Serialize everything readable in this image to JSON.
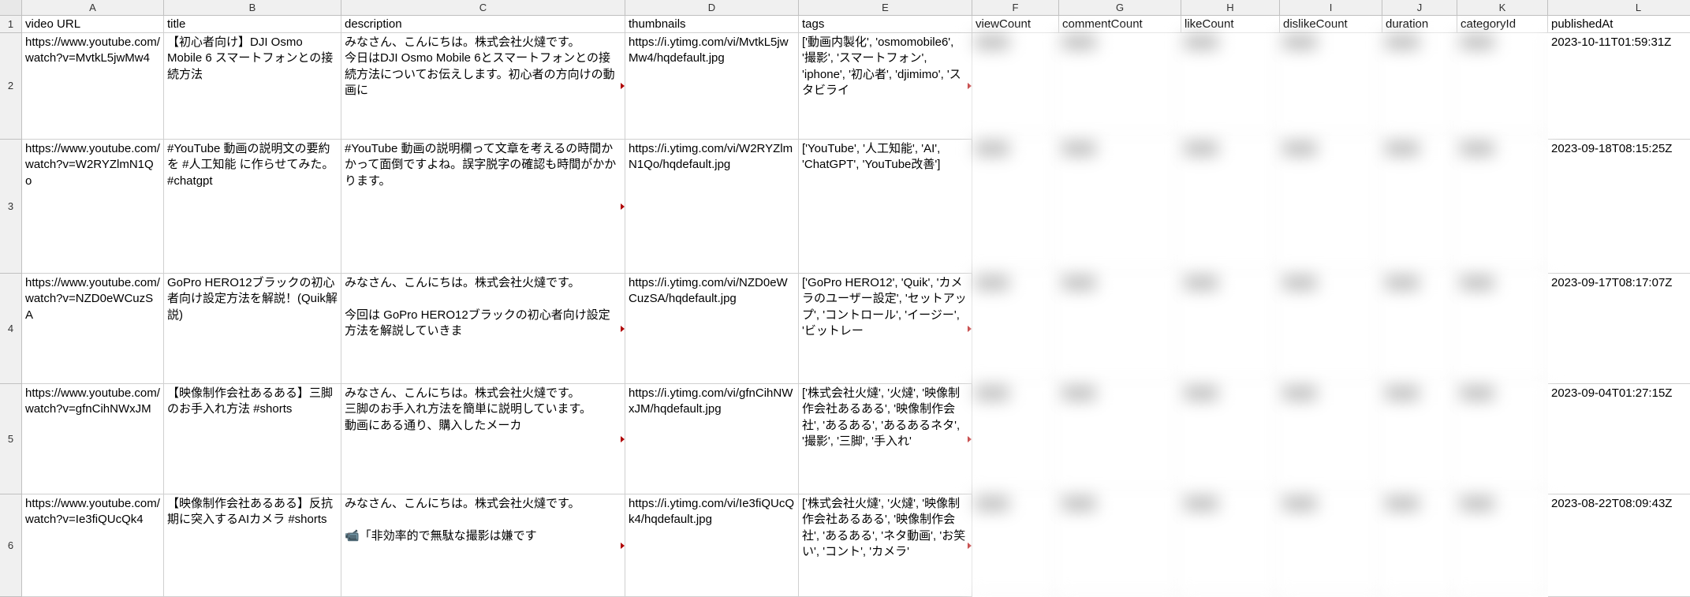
{
  "columns": [
    "A",
    "B",
    "C",
    "D",
    "E",
    "F",
    "G",
    "H",
    "I",
    "J",
    "K",
    "L"
  ],
  "headers": {
    "A": "video URL",
    "B": "title",
    "C": "description",
    "D": "thumbnails",
    "E": "tags",
    "F": "viewCount",
    "G": "commentCount",
    "H": "likeCount",
    "I": "dislikeCount",
    "J": "duration",
    "K": "categoryId",
    "L": "publishedAt"
  },
  "rows": [
    {
      "n": "2",
      "A": "https://www.youtube.com/watch?v=MvtkL5jwMw4",
      "B": "【初心者向け】DJI Osmo Mobile 6 スマートフォンとの接続方法",
      "C": "みなさん、こんにちは。株式会社火燵です。\n今日はDJI Osmo Mobile 6とスマートフォンとの接続方法についてお伝えします。初心者の方向けの動画に",
      "D": "https://i.ytimg.com/vi/MvtkL5jwMw4/hqdefault.jpg",
      "E": "['動画内製化', 'osmomobile6', '撮影', 'スマートフォン', 'iphone', '初心者', 'djimimo', 'スタビライ",
      "L": "2023-10-11T01:59:31Z"
    },
    {
      "n": "3",
      "A": "https://www.youtube.com/watch?v=W2RYZlmN1Qo",
      "B": "#YouTube 動画の説明文の要約を #人工知能 に作らせてみた。#chatgpt",
      "C": "#YouTube 動画の説明欄って文章を考えるの時間かかって面倒ですよね。誤字脱字の確認も時間がかかります。",
      "D": "https://i.ytimg.com/vi/W2RYZlmN1Qo/hqdefault.jpg",
      "E": "['YouTube', '人工知能', 'AI', 'ChatGPT', 'YouTube改善']",
      "L": "2023-09-18T08:15:25Z"
    },
    {
      "n": "4",
      "A": "https://www.youtube.com/watch?v=NZD0eWCuzSA",
      "B": "GoPro HERO12ブラックの初心者向け設定方法を解説！(Quik解説)",
      "C": "みなさん、こんにちは。株式会社火燵です。\n\n今回は GoPro HERO12ブラックの初心者向け設定方法を解説していきま",
      "D": "https://i.ytimg.com/vi/NZD0eWCuzSA/hqdefault.jpg",
      "E": "['GoPro HERO12', 'Quik', 'カメラのユーザー設定', 'セットアップ', 'コントロール', 'イージー', 'ビットレー",
      "L": "2023-09-17T08:17:07Z"
    },
    {
      "n": "5",
      "A": "https://www.youtube.com/watch?v=gfnCihNWxJM",
      "B": "【映像制作会社あるある】三脚のお手入れ方法 #shorts",
      "C": "みなさん、こんにちは。株式会社火燵です。\n三脚のお手入れ方法を簡単に説明しています。\n動画にある通り、購入したメーカ",
      "D": "https://i.ytimg.com/vi/gfnCihNWxJM/hqdefault.jpg",
      "E": "['株式会社火燵', '火燵', '映像制作会社あるある', '映像制作会社', 'あるある', 'あるあるネタ', '撮影', '三脚', '手入れ'",
      "L": "2023-09-04T01:27:15Z"
    },
    {
      "n": "6",
      "A": "https://www.youtube.com/watch?v=Ie3fiQUcQk4",
      "B": "【映像制作会社あるある】反抗期に突入するAIカメラ #shorts",
      "C": "みなさん、こんにちは。株式会社火燵です。\n\n📹「非効率的で無駄な撮影は嫌です",
      "D": "https://i.ytimg.com/vi/Ie3fiQUcQk4/hqdefault.jpg",
      "E": "['株式会社火燵', '火燵', '映像制作会社あるある', '映像制作会社', 'あるある', 'ネタ動画', 'お笑い', 'コント', 'カメラ'",
      "L": "2023-08-22T08:09:43Z"
    }
  ],
  "blurred_columns": [
    "F",
    "G",
    "H",
    "I",
    "J",
    "K"
  ],
  "blur_placeholder": "████"
}
